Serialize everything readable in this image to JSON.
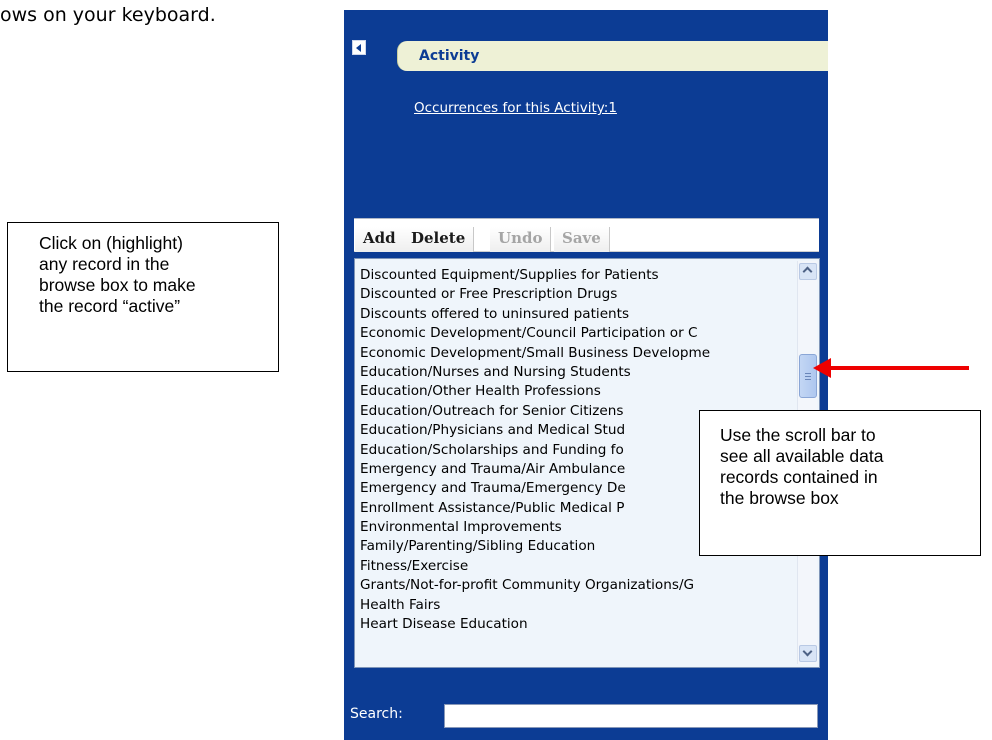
{
  "instruction_fragment": "ows on your keyboard.",
  "callouts": {
    "left": [
      "Click on (highlight)",
      "any record in the",
      "browse box to make",
      "the record “active”"
    ],
    "right": [
      "Use the scroll bar to",
      "see all available data",
      "records contained in",
      "the browse box"
    ]
  },
  "panel": {
    "tab_title": "Activity",
    "occurrences_link": "Occurrences for this Activity:1"
  },
  "toolbar": {
    "add_label": "Add",
    "delete_label": "Delete",
    "undo_label": "Undo",
    "save_label": "Save"
  },
  "browse_list": [
    "Discounted Equipment/Supplies for Patients",
    "Discounted or Free Prescription Drugs",
    "Discounts offered to uninsured patients",
    "Economic Development/Council Participation or C",
    "Economic Development/Small Business Developme",
    "Education/Nurses and Nursing Students",
    "Education/Other Health Professions",
    "Education/Outreach for Senior Citizens",
    "Education/Physicians and Medical Stud",
    "Education/Scholarships and Funding fo",
    "Emergency and Trauma/Air Ambulance",
    "Emergency and Trauma/Emergency De",
    "Enrollment Assistance/Public Medical P",
    "Environmental Improvements",
    "Family/Parenting/Sibling Education",
    "Fitness/Exercise",
    "Grants/Not-for-profit Community Organizations/G",
    "Health Fairs",
    "Heart Disease Education"
  ],
  "search": {
    "label": "Search:",
    "value": ""
  },
  "colors": {
    "panel_bg": "#0c3c94",
    "tab_bg": "#eef1d6",
    "list_bg": "#eff5fb",
    "arrow": "#ee0000"
  },
  "icons": {
    "collapse": "collapse-left-icon",
    "scroll_up": "chevron-up-icon",
    "scroll_down": "chevron-down-icon"
  }
}
